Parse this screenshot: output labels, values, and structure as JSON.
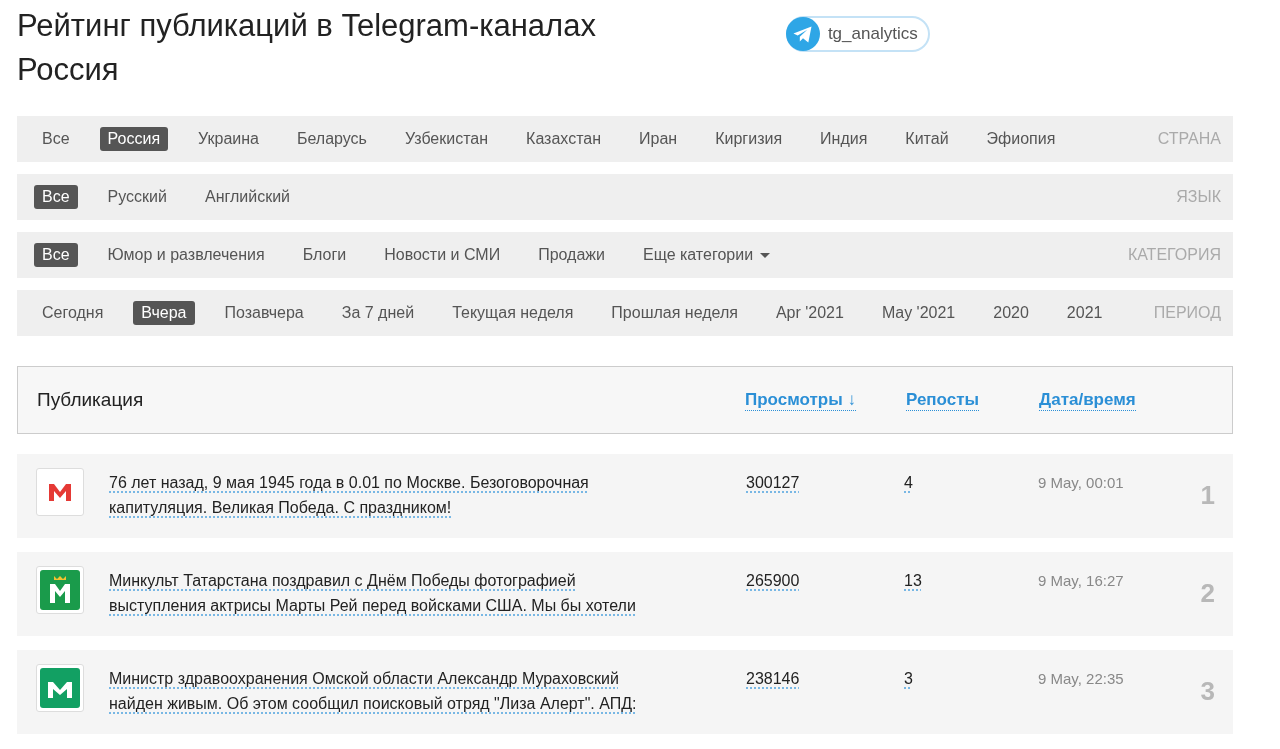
{
  "title": "Рейтинг публикаций в Telegram-каналах",
  "subtitle": "Россия",
  "badge": {
    "label": "tg_analytics"
  },
  "filters": [
    {
      "label": "СТРАНА",
      "options": [
        {
          "label": "Все",
          "selected": false
        },
        {
          "label": "Россия",
          "selected": true
        },
        {
          "label": "Украина",
          "selected": false
        },
        {
          "label": "Беларусь",
          "selected": false
        },
        {
          "label": "Узбекистан",
          "selected": false
        },
        {
          "label": "Казахстан",
          "selected": false
        },
        {
          "label": "Иран",
          "selected": false
        },
        {
          "label": "Киргизия",
          "selected": false
        },
        {
          "label": "Индия",
          "selected": false
        },
        {
          "label": "Китай",
          "selected": false
        },
        {
          "label": "Эфиопия",
          "selected": false
        }
      ]
    },
    {
      "label": "ЯЗЫК",
      "options": [
        {
          "label": "Все",
          "selected": true
        },
        {
          "label": "Русский",
          "selected": false
        },
        {
          "label": "Английский",
          "selected": false
        }
      ]
    },
    {
      "label": "КАТЕГОРИЯ",
      "options": [
        {
          "label": "Все",
          "selected": true
        },
        {
          "label": "Юмор и развлечения",
          "selected": false
        },
        {
          "label": "Блоги",
          "selected": false
        },
        {
          "label": "Новости и СМИ",
          "selected": false
        },
        {
          "label": "Продажи",
          "selected": false
        },
        {
          "label": "Еще категории",
          "selected": false,
          "dropdown": true
        }
      ]
    },
    {
      "label": "ПЕРИОД",
      "options": [
        {
          "label": "Сегодня",
          "selected": false
        },
        {
          "label": "Вчера",
          "selected": true
        },
        {
          "label": "Позавчера",
          "selected": false
        },
        {
          "label": "За 7 дней",
          "selected": false
        },
        {
          "label": "Текущая неделя",
          "selected": false
        },
        {
          "label": "Прошлая неделя",
          "selected": false
        },
        {
          "label": "Apr '2021",
          "selected": false
        },
        {
          "label": "May '2021",
          "selected": false
        },
        {
          "label": "2020",
          "selected": false
        },
        {
          "label": "2021",
          "selected": false
        }
      ]
    }
  ],
  "table": {
    "columns": [
      "Публикация",
      "Просмотры ↓",
      "Репосты",
      "Дата/время"
    ],
    "rows": [
      {
        "avatar": {
          "kind": "red-m"
        },
        "text": "76 лет назад, 9 мая 1945 года в 0.01 по Москве. Безоговорочная капитуляция. Великая Победа. С праздником!",
        "views": "300127",
        "reposts": "4",
        "date": "9 May, 00:01",
        "rank": "1"
      },
      {
        "avatar": {
          "kind": "green-crown-m"
        },
        "text": "Минкульт Татарстана поздравил с Днём Победы фотографией выступления актрисы Марты Рей перед войсками США. Мы бы хотели",
        "views": "265900",
        "reposts": "13",
        "date": "9 May, 16:27",
        "rank": "2"
      },
      {
        "avatar": {
          "kind": "green-m"
        },
        "text": "Министр здравоохранения Омской области Александр Мураховский найден живым. Об этом сообщил поисковый отряд \"Лиза Алерт\". АПД:",
        "views": "238146",
        "reposts": "3",
        "date": "9 May, 22:35",
        "rank": "3"
      }
    ]
  }
}
